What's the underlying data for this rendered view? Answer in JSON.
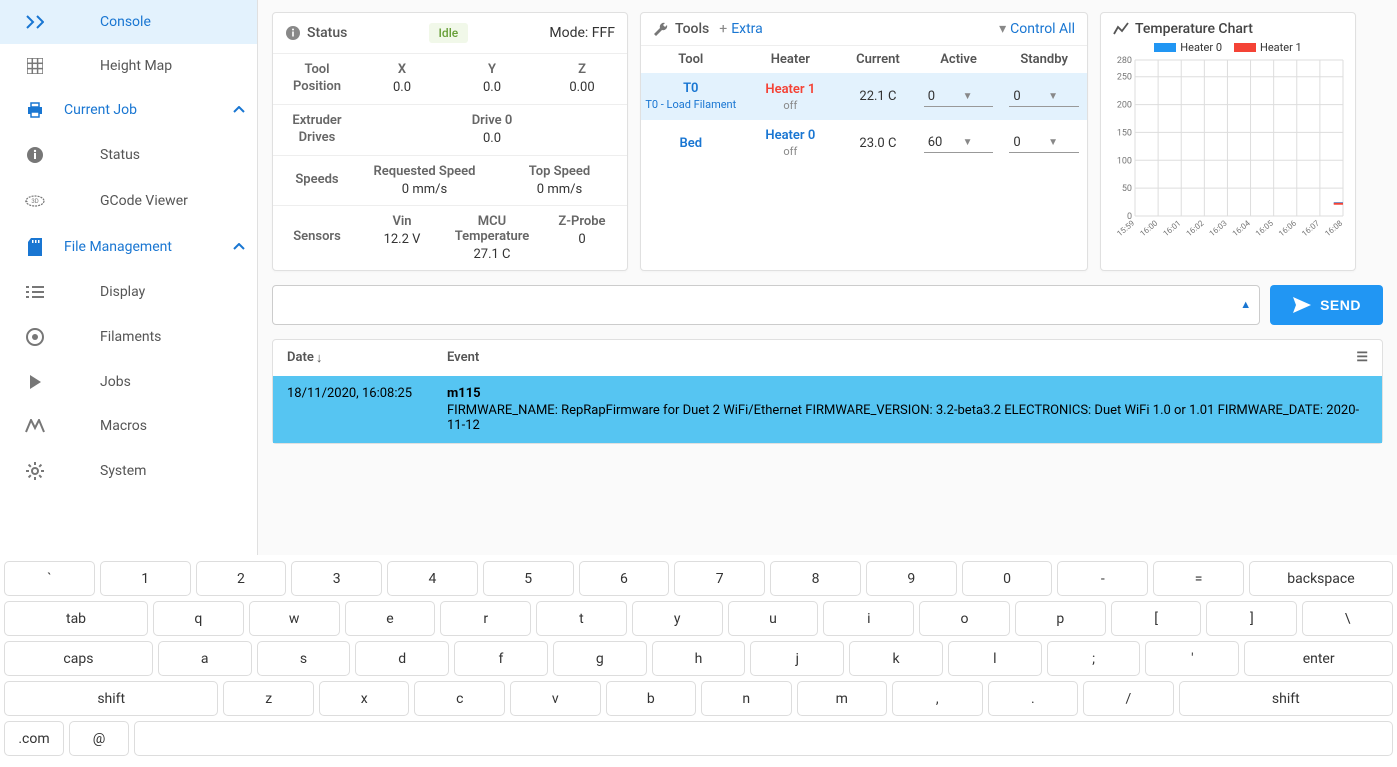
{
  "sidebar": {
    "console": "Console",
    "heightmap": "Height Map",
    "currentjob": "Current Job",
    "status": "Status",
    "gcodeviewer": "GCode Viewer",
    "filemgmt": "File Management",
    "display": "Display",
    "filaments": "Filaments",
    "jobs": "Jobs",
    "macros": "Macros",
    "system": "System"
  },
  "status": {
    "title": "Status",
    "badge": "Idle",
    "mode": "Mode: FFF",
    "toolpos_label": "Tool Position",
    "x": "X",
    "xv": "0.0",
    "y": "Y",
    "yv": "0.0",
    "z": "Z",
    "zv": "0.00",
    "extruder_label": "Extruder Drives",
    "drive0": "Drive 0",
    "drive0v": "0.0",
    "speeds_label": "Speeds",
    "req": "Requested Speed",
    "reqv": "0 mm/s",
    "top": "Top Speed",
    "topv": "0 mm/s",
    "sensors_label": "Sensors",
    "vin": "Vin",
    "vinv": "12.2 V",
    "mcu": "MCU Temperature",
    "mcuv": "27.1 C",
    "zprobe": "Z-Probe",
    "zprobev": "0"
  },
  "tools": {
    "title": "Tools",
    "extra": "Extra",
    "controlall": "Control All",
    "heads": {
      "tool": "Tool",
      "heater": "Heater",
      "current": "Current",
      "active": "Active",
      "standby": "Standby"
    },
    "row1": {
      "tool": "T0",
      "sub": "T0 - Load Filament",
      "heater": "Heater 1",
      "state": "off",
      "current": "22.1 C",
      "active": "0",
      "standby": "0"
    },
    "row2": {
      "tool": "Bed",
      "heater": "Heater 0",
      "state": "off",
      "current": "23.0 C",
      "active": "60",
      "standby": "0"
    }
  },
  "chart": {
    "title": "Temperature Chart",
    "legend0": "Heater 0",
    "legend1": "Heater 1"
  },
  "chart_data": {
    "type": "line",
    "title": "Temperature Chart",
    "xlabel": "",
    "ylabel": "",
    "ylim": [
      0,
      280
    ],
    "x": [
      "15:59",
      "16:00",
      "16:01",
      "16:02",
      "16:03",
      "16:04",
      "16:05",
      "16:06",
      "16:07",
      "16:08"
    ],
    "series": [
      {
        "name": "Heater 0",
        "color": "#2196f3",
        "values": [
          null,
          null,
          null,
          null,
          null,
          null,
          null,
          null,
          null,
          23
        ]
      },
      {
        "name": "Heater 1",
        "color": "#f44336",
        "values": [
          null,
          null,
          null,
          null,
          null,
          null,
          null,
          null,
          null,
          22
        ]
      }
    ]
  },
  "cmd": {
    "send": "SEND"
  },
  "console": {
    "date_h": "Date",
    "event_h": "Event",
    "row": {
      "date": "18/11/2020, 16:08:25",
      "cmd": "m115",
      "out": "FIRMWARE_NAME: RepRapFirmware for Duet 2 WiFi/Ethernet FIRMWARE_VERSION: 3.2-beta3.2 ELECTRONICS: Duet WiFi 1.0 or 1.01 FIRMWARE_DATE: 2020-11-12"
    }
  },
  "kb": {
    "r1": [
      "`",
      "1",
      "2",
      "3",
      "4",
      "5",
      "6",
      "7",
      "8",
      "9",
      "0",
      "-",
      "=",
      "backspace"
    ],
    "r2": [
      "tab",
      "q",
      "w",
      "e",
      "r",
      "t",
      "y",
      "u",
      "i",
      "o",
      "p",
      "[",
      "]",
      "\\"
    ],
    "r3": [
      "caps",
      "a",
      "s",
      "d",
      "f",
      "g",
      "h",
      "j",
      "k",
      "l",
      ";",
      "'",
      "enter"
    ],
    "r4": [
      "shift",
      "z",
      "x",
      "c",
      "v",
      "b",
      "n",
      "m",
      ",",
      ".",
      "/",
      "shift"
    ],
    "r5": [
      ".com",
      "@",
      ""
    ]
  }
}
